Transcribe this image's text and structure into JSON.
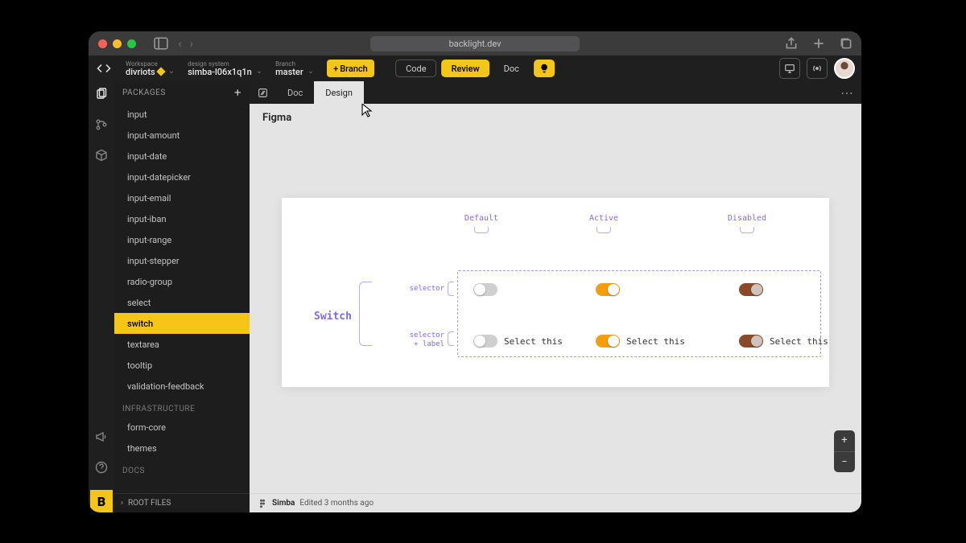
{
  "browser": {
    "url": "backlight.dev"
  },
  "context": {
    "workspace_label": "Workspace",
    "workspace_value": "divriots",
    "design_system_label": "design system",
    "design_system_value": "simba-l06x1q1n",
    "branch_label": "Branch",
    "branch_value": "master",
    "branch_button": "Branch",
    "center": {
      "code": "Code",
      "review": "Review",
      "doc": "Doc"
    }
  },
  "sidebar": {
    "header": "PACKAGES",
    "items": [
      "input",
      "input-amount",
      "input-date",
      "input-datepicker",
      "input-email",
      "input-iban",
      "input-range",
      "input-stepper",
      "radio-group",
      "select",
      "switch",
      "textarea",
      "tooltip",
      "validation-feedback"
    ],
    "active_index": 10,
    "section2": "INFRASTRUCTURE",
    "items2": [
      "form-core",
      "themes"
    ],
    "section3": "DOCS",
    "root_files": "ROOT FILES"
  },
  "tabs": {
    "doc": "Doc",
    "design": "Design"
  },
  "canvas": {
    "title": "Figma",
    "frame": {
      "component": "Switch",
      "columns": [
        "Default",
        "Active",
        "Disabled"
      ],
      "rows": [
        {
          "label": "selector"
        },
        {
          "label_l1": "selector",
          "label_l2": "+ label"
        }
      ],
      "sample_label": "Select this"
    }
  },
  "footer": {
    "name": "Simba",
    "meta": "Edited 3 months ago"
  },
  "zoom": {
    "in": "+",
    "out": "−"
  }
}
